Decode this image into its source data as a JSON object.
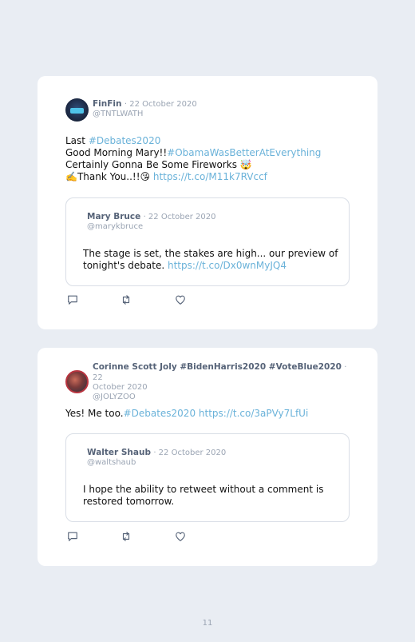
{
  "tweets": [
    {
      "name": "FinFin",
      "date": "· 22 October 2020",
      "handle": "@TNTLWATH",
      "lines": [
        {
          "plain": "Last ",
          "link": "#Debates2020"
        },
        {
          "plain": "Good Morning Mary!!",
          "link": "#ObamaWasBetterAtEverything"
        },
        {
          "plain": "Certainly Gonna Be Some Fireworks 🤯",
          "link": ""
        },
        {
          "plain": "✍️Thank You..!!😘 ",
          "link": "https://t.co/M11k7RVccf"
        }
      ],
      "quote": {
        "name": "Mary Bruce",
        "date": "· 22 October 2020",
        "handle": "@marykbruce",
        "text_plain": "The stage is set, the stakes are high... our preview of tonight's debate. ",
        "text_link": "https://t.co/Dx0wnMyJQ4"
      }
    },
    {
      "name": "Corinne Scott Joly #BidenHarris2020 #VoteBlue2020",
      "date": "· 22",
      "date_cont": "October 2020",
      "handle": "@JOLYZOO",
      "lines": [
        {
          "plain": "Yes! Me too.",
          "link": "#Debates2020 https://t.co/3aPVy7LfUi"
        }
      ],
      "quote": {
        "name": "Walter Shaub",
        "date": "· 22 October 2020",
        "handle": "@waltshaub",
        "text_plain": "I hope the ability to retweet without a comment is restored tomorrow.",
        "text_link": ""
      }
    }
  ],
  "icons": [
    "reply-icon",
    "retweet-icon",
    "like-icon"
  ],
  "page_number": "11",
  "colors": {
    "link": "#6ab2d9",
    "name": "#566378",
    "meta": "#9aa4b3",
    "background": "#e9edf3"
  }
}
